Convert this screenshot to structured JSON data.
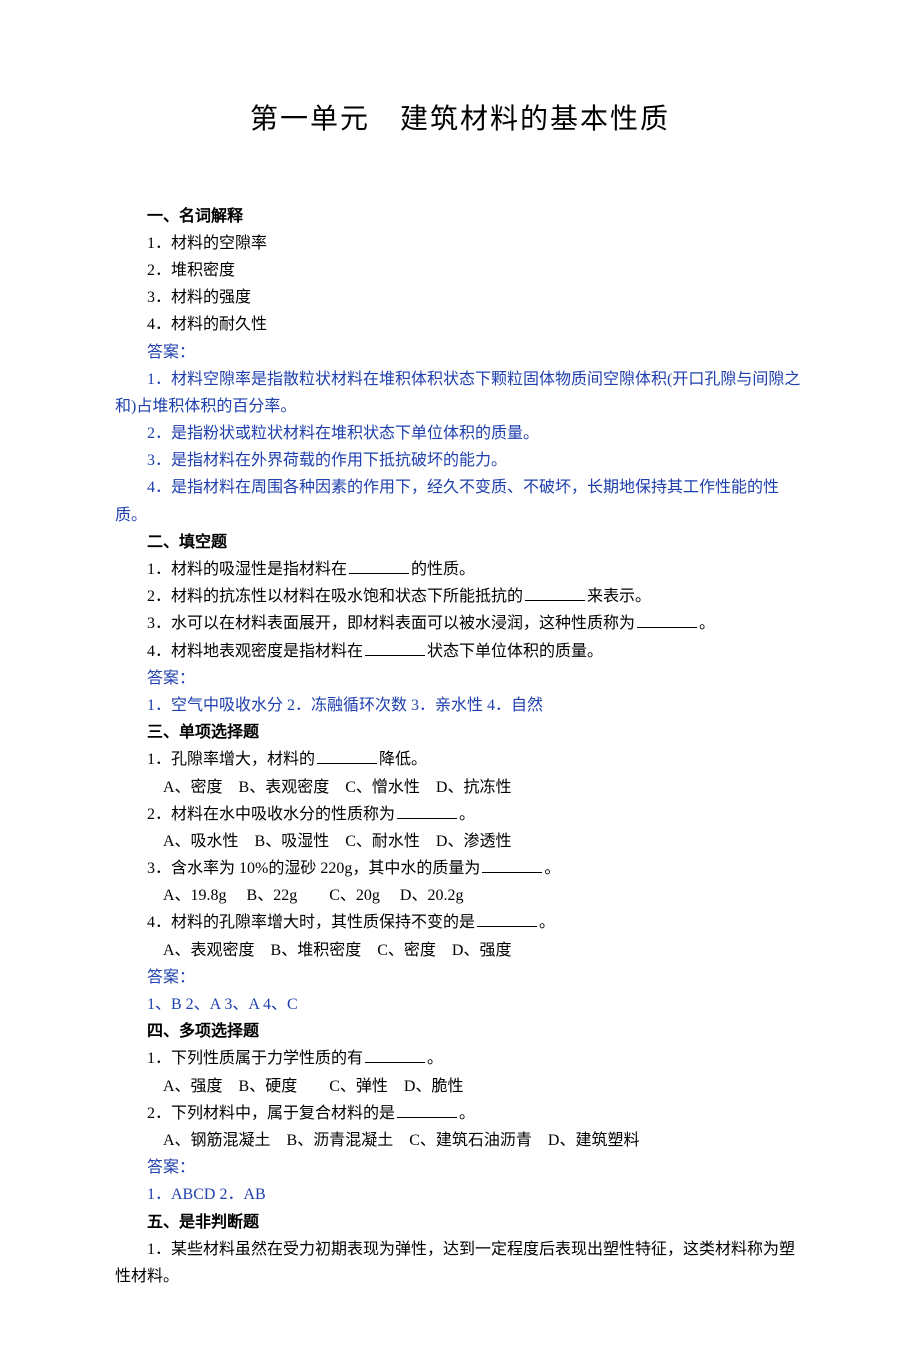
{
  "title": "第一单元　建筑材料的基本性质",
  "s1": {
    "heading": "一、名词解释",
    "items": [
      "1．材料的空隙率",
      "2．堆积密度",
      "3．材料的强度",
      "4．材料的耐久性"
    ],
    "ansLabel": "答案：",
    "answers": [
      "1．材料空隙率是指散粒状材料在堆积体积状态下颗粒固体物质间空隙体积(开口孔隙与间隙之和)占堆积体积的百分率。",
      "2．是指粉状或粒状材料在堆积状态下单位体积的质量。",
      "3．是指材料在外界荷载的作用下抵抗破坏的能力。",
      "4．是指材料在周围各种因素的作用下，经久不变质、不破坏，长期地保持其工作性能的性质。"
    ]
  },
  "s2": {
    "heading": "二、填空题",
    "q1a": "1．材料的吸湿性是指材料在",
    "q1b": "的性质。",
    "q2a": "2．材料的抗冻性以材料在吸水饱和状态下所能抵抗的",
    "q2b": "来表示。",
    "q3a": "3．水可以在材料表面展开，即材料表面可以被水浸润，这种性质称为",
    "q3b": "。",
    "q4a": "4．材料地表观密度是指材料在",
    "q4b": "状态下单位体积的质量。",
    "ansLabel": "答案：",
    "answers": "1．空气中吸收水分 2．冻融循环次数 3．亲水性 4．自然"
  },
  "s3": {
    "heading": "三、单项选择题",
    "q1a": "1．孔隙率增大，材料的",
    "q1b": "降低。",
    "o1": "A、密度　B、表观密度　C、憎水性　D、抗冻性",
    "q2a": "2．材料在水中吸收水分的性质称为",
    "q2b": "。",
    "o2": "A、吸水性　B、吸湿性　C、耐水性　D、渗透性",
    "q3a": "3．含水率为 10%的湿砂 220g，其中水的质量为",
    "q3b": "。",
    "o3": "A、19.8g　 B、22g　　C、20g　 D、20.2g",
    "q4a": "4．材料的孔隙率增大时，其性质保持不变的是",
    "q4b": "。",
    "o4": "A、表观密度　B、堆积密度　C、密度　D、强度",
    "ansLabel": "答案：",
    "answers": "1、B 2、A 3、A  4、C"
  },
  "s4": {
    "heading": "四、多项选择题",
    "q1a": "1．下列性质属于力学性质的有",
    "q1b": "。",
    "o1": "A、强度　B、硬度　　C、弹性　D、脆性",
    "q2a": "2．下列材料中，属于复合材料的是",
    "q2b": "。",
    "o2": "A、钢筋混凝土　B、沥青混凝土　C、建筑石油沥青　D、建筑塑料",
    "ansLabel": "答案：",
    "answers": "1．ABCD 2．AB"
  },
  "s5": {
    "heading": "五、是非判断题",
    "q1": "1．某些材料虽然在受力初期表现为弹性，达到一定程度后表现出塑性特征，这类材料称为塑性材料。"
  }
}
